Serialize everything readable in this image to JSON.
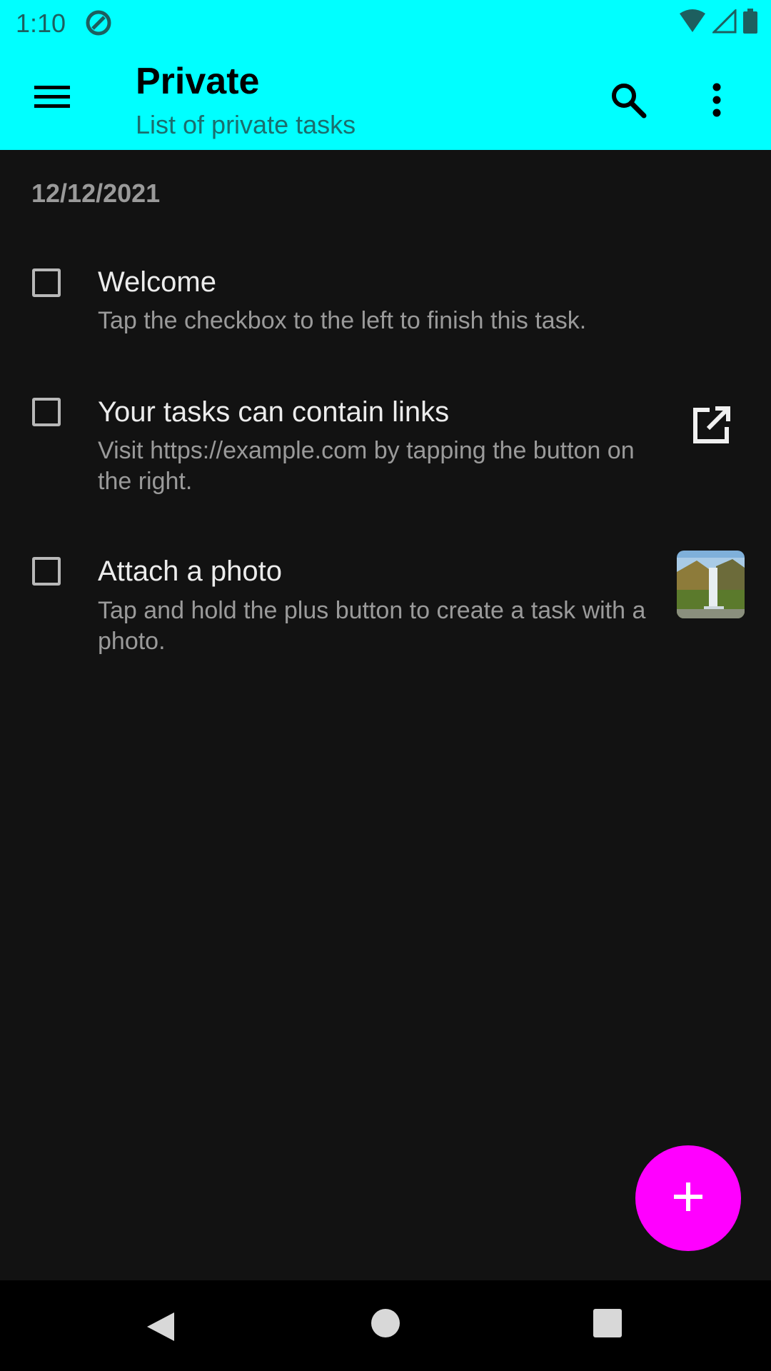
{
  "status_bar": {
    "time": "1:10"
  },
  "app_bar": {
    "title": "Private",
    "subtitle": "List of private tasks"
  },
  "date_header": "12/12/2021",
  "tasks": [
    {
      "title": "Welcome",
      "description": "Tap the checkbox to the left to finish this task."
    },
    {
      "title": "Your tasks can contain links",
      "description": "Visit https://example.com by tapping the button on the right."
    },
    {
      "title": "Attach a photo",
      "description": "Tap and hold the plus button to create a task with a photo."
    }
  ],
  "colors": {
    "accent": "#00FFFF",
    "fab": "#FF00FF",
    "background": "#121212"
  },
  "icons": [
    "menu-icon",
    "search-icon",
    "more-vert-icon",
    "open-in-new-icon",
    "add-icon",
    "back-icon",
    "home-icon",
    "recents-icon"
  ]
}
